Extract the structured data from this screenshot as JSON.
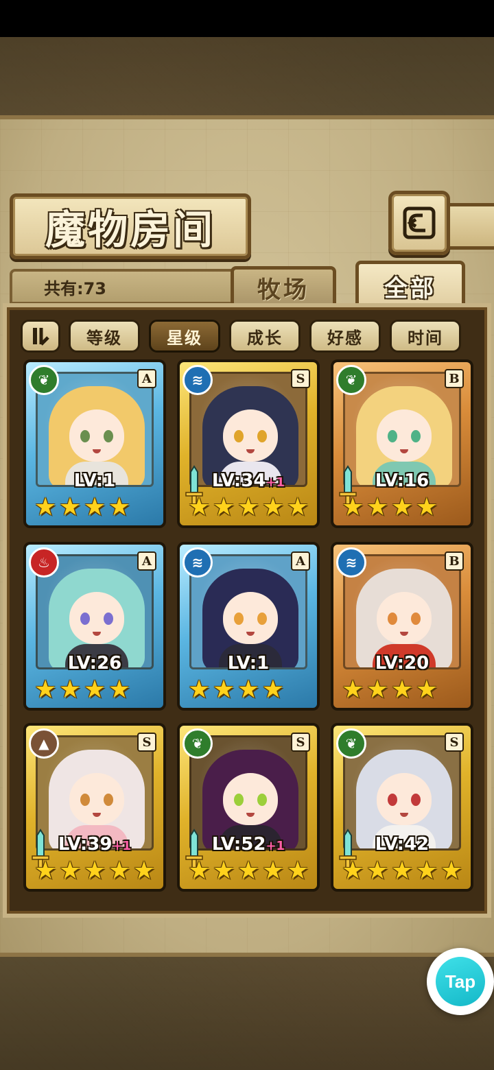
{
  "header": {
    "title": "魔物房间",
    "back_icon": "back-arrow-icon"
  },
  "count_label": "共有:73",
  "tabs": [
    {
      "label": "牧场",
      "active": false
    },
    {
      "label": "全部",
      "active": true
    }
  ],
  "sort": {
    "toggle_label": "⇂",
    "buttons": [
      {
        "label": "等级",
        "active": false
      },
      {
        "label": "星级",
        "active": true
      },
      {
        "label": "成长",
        "active": false
      },
      {
        "label": "好感",
        "active": false
      },
      {
        "label": "时间",
        "active": false
      }
    ]
  },
  "monsters": [
    {
      "lv": "LV:1",
      "plus": "",
      "rank": "A",
      "element": "wood",
      "frame": "blue",
      "stars": 4,
      "hair": "#f2c96a",
      "eye": "#6a8f4f",
      "outfit": "#e8e4dc",
      "bg": "#5fa9cc",
      "sword": false
    },
    {
      "lv": "LV:34",
      "plus": "+1",
      "rank": "S",
      "element": "water",
      "frame": "gold",
      "stars": 5,
      "hair": "#2f3452",
      "eye": "#e0a42a",
      "outfit": "#e9e6ee",
      "bg": "#8c6a3a",
      "sword": true
    },
    {
      "lv": "LV:16",
      "plus": "",
      "rank": "B",
      "element": "wood",
      "frame": "bronze",
      "stars": 4,
      "hair": "#f3d27e",
      "eye": "#4fb287",
      "outfit": "#7fc8b1",
      "bg": "#c88a4a",
      "sword": true
    },
    {
      "lv": "LV:26",
      "plus": "",
      "rank": "A",
      "element": "fire",
      "frame": "blue",
      "stars": 4,
      "hair": "#8fd8cf",
      "eye": "#7b6fd0",
      "outfit": "#3b3b44",
      "bg": "#4f91b4",
      "sword": false
    },
    {
      "lv": "LV:1",
      "plus": "",
      "rank": "A",
      "element": "water",
      "frame": "blue",
      "stars": 4,
      "hair": "#2a2b55",
      "eye": "#e8a03a",
      "outfit": "#2b2a3a",
      "bg": "#5fa2c8",
      "sword": false
    },
    {
      "lv": "LV:20",
      "plus": "",
      "rank": "B",
      "element": "water",
      "frame": "bronze",
      "stars": 4,
      "hair": "#e7ddd6",
      "eye": "#e08a3c",
      "outfit": "#d03a2a",
      "bg": "#c58244",
      "sword": false
    },
    {
      "lv": "LV:39",
      "plus": "+1",
      "rank": "S",
      "element": "earth",
      "frame": "gold",
      "stars": 5,
      "hair": "#efe5e4",
      "eye": "#d08a3a",
      "outfit": "#f3b9c2",
      "bg": "#9b7e43",
      "sword": true
    },
    {
      "lv": "LV:52",
      "plus": "+1",
      "rank": "S",
      "element": "wood",
      "frame": "gold",
      "stars": 5,
      "hair": "#4a1e4a",
      "eye": "#9ccf3a",
      "outfit": "#2b2430",
      "bg": "#6a5330",
      "sword": true
    },
    {
      "lv": "LV:42",
      "plus": "",
      "rank": "S",
      "element": "wood",
      "frame": "gold",
      "stars": 5,
      "hair": "#d9dce6",
      "eye": "#c23a3a",
      "outfit": "#f3f1ee",
      "bg": "#8a7044",
      "sword": true
    }
  ],
  "tap_label": "Tap",
  "colors": {
    "panel": "#3f2d15",
    "parchment": "#d6c79d",
    "accent_brown": "#6b4d22",
    "star": "#ffd21c",
    "level_plus": "#ff5fa8",
    "tap": "#14b8c8"
  }
}
